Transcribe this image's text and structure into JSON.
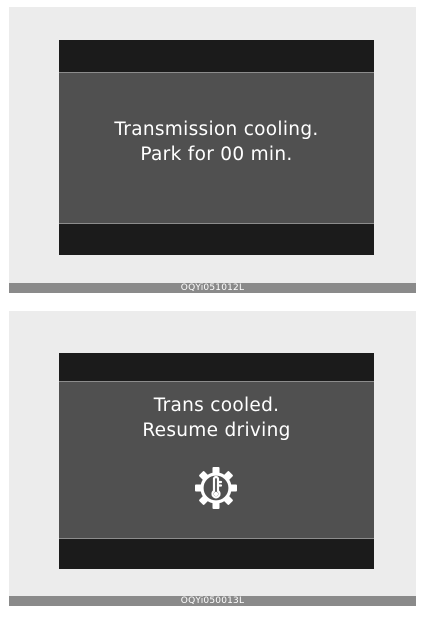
{
  "panels": [
    {
      "message_lines": [
        "Transmission cooling.",
        "Park for 00 min."
      ],
      "caption": "OQYi051012L"
    },
    {
      "message_lines": [
        "Trans cooled.",
        "Resume driving"
      ],
      "icon": "transmission-temperature-gear-icon",
      "caption": "OQYi050013L"
    }
  ]
}
